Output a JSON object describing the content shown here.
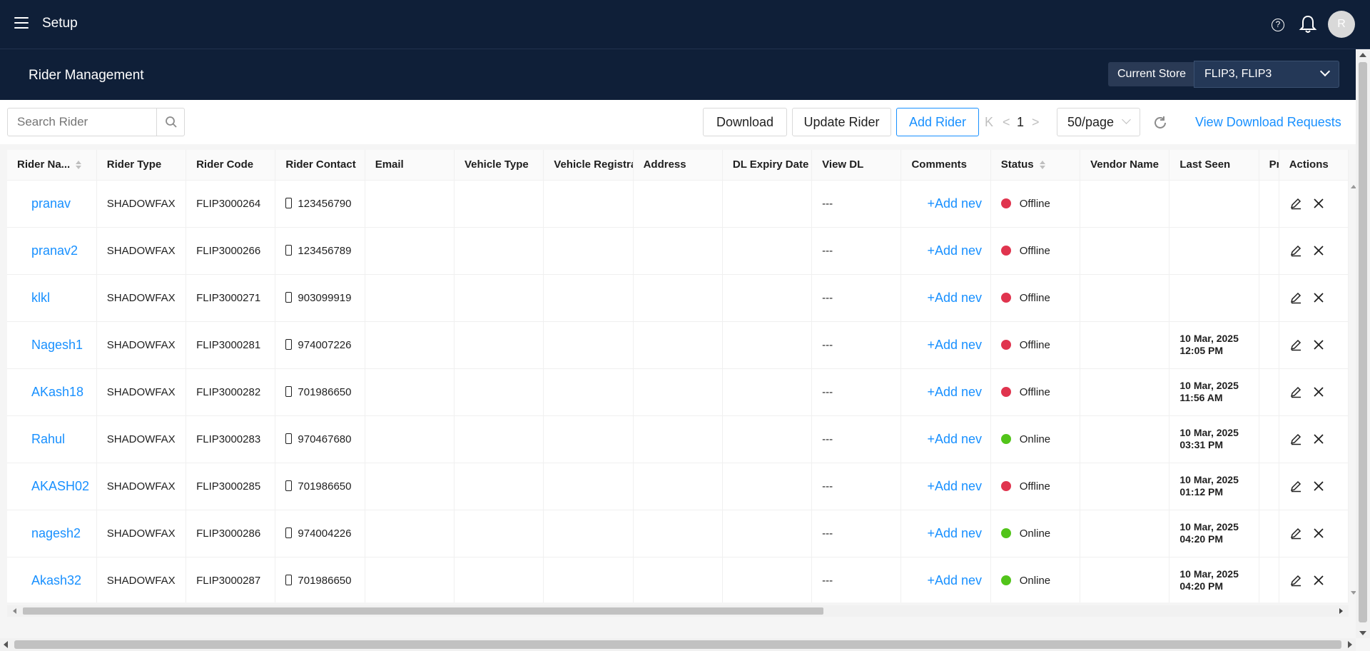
{
  "header": {
    "app_title": "Setup",
    "avatar_initial": "R",
    "icons": [
      "menu-icon",
      "help-icon",
      "bell-icon"
    ]
  },
  "subheader": {
    "page_title": "Rider Management",
    "store_label": "Current Store",
    "store_value": "FLIP3, FLIP3"
  },
  "toolbar": {
    "search_placeholder": "Search Rider",
    "download_label": "Download",
    "update_label": "Update Rider",
    "add_label": "Add Rider",
    "first_page_glyph": "K",
    "prev_glyph": "<",
    "current_page": "1",
    "next_glyph": ">",
    "page_size": "50/page",
    "view_requests_label": "View Download Requests"
  },
  "table": {
    "columns": [
      "Rider Na...",
      "Rider Type",
      "Rider Code",
      "Rider Contact",
      "Email",
      "Vehicle Type",
      "Vehicle Registrat",
      "Address",
      "DL Expiry Date",
      "View DL",
      "Comments",
      "Status",
      "Vendor Name",
      "Last Seen",
      "Pr",
      "Actions"
    ],
    "rows": [
      {
        "name": "pranav",
        "type": "SHADOWFAX",
        "code": "FLIP3000264",
        "contact": "123456790",
        "view_dl": "---",
        "comment": "+Add nev",
        "status": "Offline",
        "last_seen_date": "",
        "last_seen_time": ""
      },
      {
        "name": "pranav2",
        "type": "SHADOWFAX",
        "code": "FLIP3000266",
        "contact": "123456789",
        "view_dl": "---",
        "comment": "+Add nev",
        "status": "Offline",
        "last_seen_date": "",
        "last_seen_time": ""
      },
      {
        "name": "klkl",
        "type": "SHADOWFAX",
        "code": "FLIP3000271",
        "contact": "903099919",
        "view_dl": "---",
        "comment": "+Add nev",
        "status": "Offline",
        "last_seen_date": "",
        "last_seen_time": ""
      },
      {
        "name": "Nagesh1",
        "type": "SHADOWFAX",
        "code": "FLIP3000281",
        "contact": "974007226",
        "view_dl": "---",
        "comment": "+Add nev",
        "status": "Offline",
        "last_seen_date": "10 Mar, 2025",
        "last_seen_time": "12:05 PM"
      },
      {
        "name": "AKash18",
        "type": "SHADOWFAX",
        "code": "FLIP3000282",
        "contact": "701986650",
        "view_dl": "---",
        "comment": "+Add nev",
        "status": "Offline",
        "last_seen_date": "10 Mar, 2025",
        "last_seen_time": "11:56 AM"
      },
      {
        "name": "Rahul",
        "type": "SHADOWFAX",
        "code": "FLIP3000283",
        "contact": "970467680",
        "view_dl": "---",
        "comment": "+Add nev",
        "status": "Online",
        "last_seen_date": "10 Mar, 2025",
        "last_seen_time": "03:31 PM"
      },
      {
        "name": "AKASH02",
        "type": "SHADOWFAX",
        "code": "FLIP3000285",
        "contact": "701986650",
        "view_dl": "---",
        "comment": "+Add nev",
        "status": "Offline",
        "last_seen_date": "10 Mar, 2025",
        "last_seen_time": "01:12 PM"
      },
      {
        "name": "nagesh2",
        "type": "SHADOWFAX",
        "code": "FLIP3000286",
        "contact": "974004226",
        "view_dl": "---",
        "comment": "+Add nev",
        "status": "Online",
        "last_seen_date": "10 Mar, 2025",
        "last_seen_time": "04:20 PM"
      },
      {
        "name": "Akash32",
        "type": "SHADOWFAX",
        "code": "FLIP3000287",
        "contact": "701986650",
        "view_dl": "---",
        "comment": "+Add nev",
        "status": "Online",
        "last_seen_date": "10 Mar, 2025",
        "last_seen_time": "04:20 PM"
      }
    ]
  },
  "colors": {
    "header_bg": "#0f1f38",
    "link": "#1890ff",
    "offline": "#e0344e",
    "online": "#52c41a"
  }
}
